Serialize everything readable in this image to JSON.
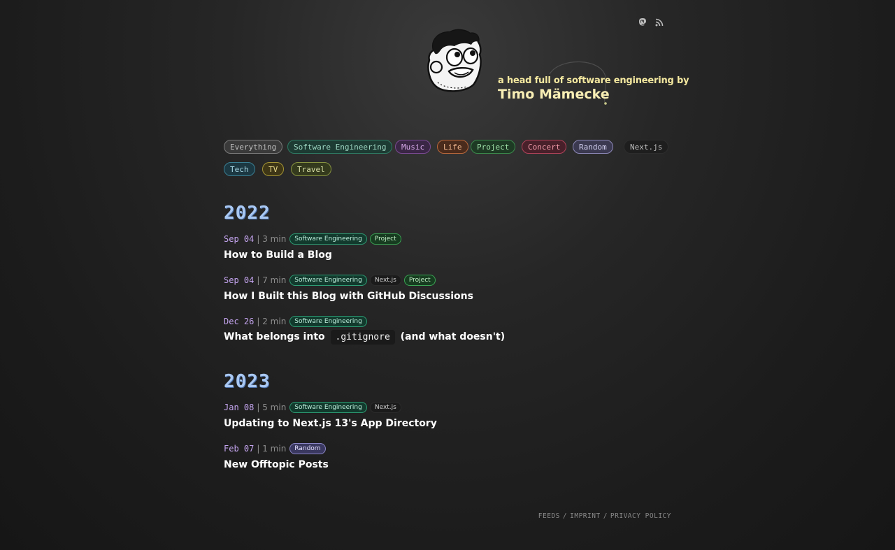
{
  "header": {
    "icons": [
      "mastodon-icon",
      "rss-icon"
    ],
    "tagline": "a head full of software engineering by",
    "author": "Timo Mämecke"
  },
  "filters": [
    {
      "label": "Everything",
      "color": "#bdbdbd",
      "bg": "#3a3a3a",
      "border": "#7a7a7a"
    },
    {
      "label": "Software Engineering",
      "color": "#9fd8c4",
      "bg": "#1d3b33",
      "border": "#2e7a63"
    },
    {
      "label": "Music",
      "color": "#d6a8e8",
      "bg": "#3a2645",
      "border": "#7b4a94"
    },
    {
      "label": "Life",
      "color": "#f0b78f",
      "bg": "#4a2b1c",
      "border": "#b9673a"
    },
    {
      "label": "Project",
      "color": "#9fe0a8",
      "bg": "#1e3a24",
      "border": "#3a8a4b"
    },
    {
      "label": "Concert",
      "color": "#f09aa9",
      "bg": "#48202a",
      "border": "#b04259"
    },
    {
      "label": "Random",
      "color": "#d3d0f0",
      "bg": "#3b3950",
      "border": "#8d88b8"
    },
    {
      "label": "Next.js",
      "color": "#bcbcbc",
      "bg": "#1e1e1e",
      "border": "#2d2d2d"
    },
    {
      "label": "Tech",
      "color": "#a9d8e6",
      "bg": "#1c3842",
      "border": "#3a7f93"
    },
    {
      "label": "TV",
      "color": "#e8d98a",
      "bg": "#3e3616",
      "border": "#a39434"
    },
    {
      "label": "Travel",
      "color": "#d9e0a6",
      "bg": "#343a1d",
      "border": "#879340"
    }
  ],
  "years": [
    {
      "year": "2022",
      "posts": [
        {
          "date": "Sep 04",
          "duration": "| 3 min",
          "tags": [
            "Software Engineering",
            "Project"
          ],
          "title": "How to Build a Blog"
        },
        {
          "date": "Sep 04",
          "duration": "| 7 min",
          "tags": [
            "Software Engineering",
            "Next.js",
            "Project"
          ],
          "title": "How I Built this Blog with GitHub Discussions"
        },
        {
          "date": "Dec 26",
          "duration": "| 2 min",
          "tags": [
            "Software Engineering"
          ],
          "title_before": "What belongs into",
          "title_code": ".gitignore",
          "title_after": "(and what doesn't)"
        }
      ]
    },
    {
      "year": "2023",
      "posts": [
        {
          "date": "Jan 08",
          "duration": "| 5 min",
          "tags": [
            "Software Engineering",
            "Next.js"
          ],
          "title": "Updating to Next.js 13's App Directory"
        },
        {
          "date": "Feb 07",
          "duration": "| 1 min",
          "tags": [
            "Random"
          ],
          "title": "New Offtopic Posts"
        }
      ]
    }
  ],
  "footer": {
    "feeds": "FEEDS",
    "imprint": "IMPRINT",
    "privacy": "PRIVACY POLICY",
    "separator": "/"
  }
}
